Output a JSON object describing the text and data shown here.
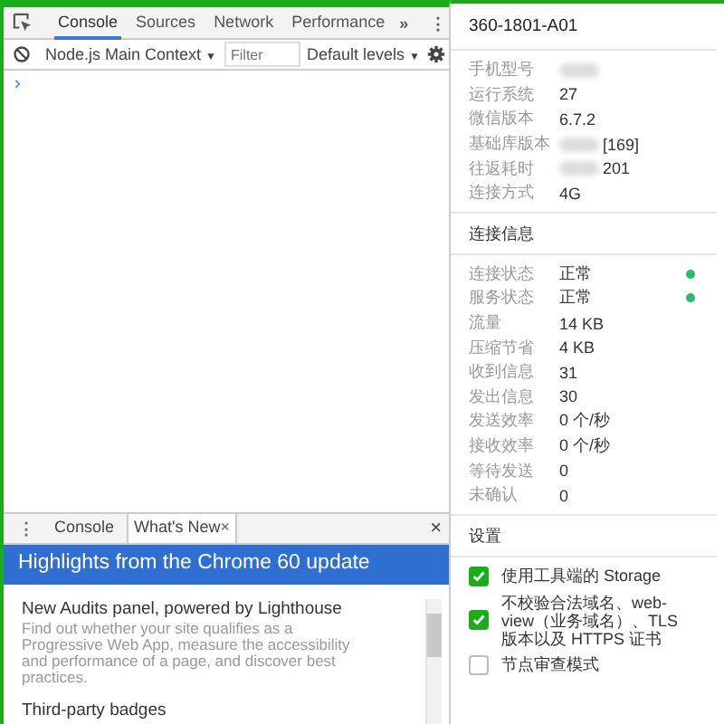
{
  "devtools": {
    "tabs": [
      {
        "label": "Console",
        "selected": true
      },
      {
        "label": "Sources",
        "selected": false
      },
      {
        "label": "Network",
        "selected": false
      },
      {
        "label": "Performance",
        "selected": false
      }
    ],
    "more": "»",
    "menu": "⋮",
    "console_toolbar": {
      "context": "Node.js Main Context",
      "context_caret": "▼",
      "filter_placeholder": "Filter",
      "levels": "Default levels",
      "levels_caret": "▼"
    },
    "prompt": "›"
  },
  "drawer": {
    "menu": "⋮",
    "tabs": [
      {
        "label": "Console",
        "selected": false
      },
      {
        "label": "What's New",
        "selected": true,
        "close": "×"
      }
    ],
    "close": "×",
    "banner": "Highlights from the Chrome 60 update",
    "articles": [
      {
        "title": "New Audits panel, powered by Lighthouse",
        "body": "Find out whether your site qualifies as a Progressive Web App, measure the accessibility and performance of a page, and discover best practices."
      },
      {
        "title": "Third-party badges"
      }
    ]
  },
  "device": {
    "title": "360-1801-A01",
    "info": [
      {
        "label": "手机型号",
        "redacted": true
      },
      {
        "label": "运行系统",
        "value": "27",
        "redacted": false
      },
      {
        "label": "微信版本",
        "value": "6.7.2",
        "redacted": false
      },
      {
        "label": "基础库版本",
        "value": "[169]",
        "redacted": true
      },
      {
        "label": "往返耗时",
        "value": "201",
        "redacted": true
      },
      {
        "label": "连接方式",
        "value": "4G",
        "redacted": false
      }
    ],
    "connection_title": "连接信息",
    "connection": [
      {
        "label": "连接状态",
        "value": "正常",
        "color": "#2eb872"
      },
      {
        "label": "服务状态",
        "value": "正常",
        "color": "#2eb872"
      },
      {
        "label": "流量",
        "value": "14 KB"
      },
      {
        "label": "压缩节省",
        "value": "4 KB"
      },
      {
        "label": "收到信息",
        "value": "31"
      },
      {
        "label": "发出信息",
        "value": "30"
      },
      {
        "label": "发送效率",
        "value": "0 个/秒"
      },
      {
        "label": "接收效率",
        "value": "0 个/秒"
      },
      {
        "label": "等待发送",
        "value": "0"
      },
      {
        "label": "未确认",
        "value": "0"
      }
    ],
    "settings_title": "设置",
    "settings": [
      {
        "label": "使用工具端的 Storage",
        "checked": true
      },
      {
        "label": "不校验合法域名、web-view（业务域名）、TLS 版本以及 HTTPS 证书",
        "checked": true
      },
      {
        "label": "节点审查模式",
        "checked": false
      }
    ]
  }
}
